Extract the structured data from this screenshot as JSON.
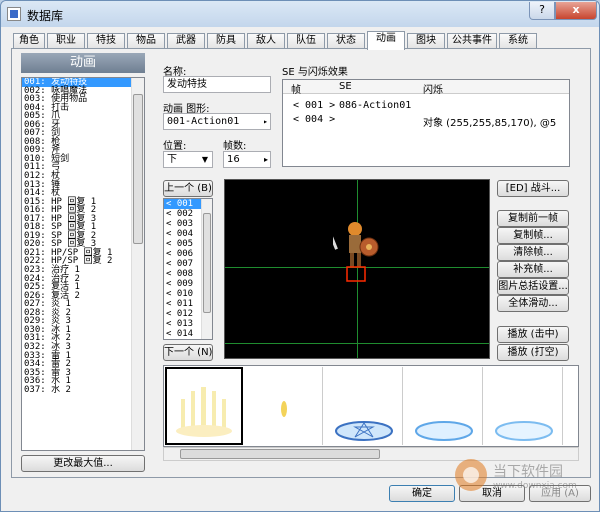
{
  "window": {
    "title": "数据库",
    "help": "?",
    "close": "x"
  },
  "tabs": [
    "角色",
    "职业",
    "特技",
    "物品",
    "武器",
    "防具",
    "敌人",
    "队伍",
    "状态",
    "动画",
    "图块",
    "公共事件",
    "系统"
  ],
  "left": {
    "header": "动画",
    "items": [
      "001: 发动特技",
      "002: 咏唱魔法",
      "003: 使用物品",
      "004: 打击",
      "005: 爪",
      "006: 牙",
      "007: 剑",
      "008: 枪",
      "009: 斧",
      "010: 短剑",
      "011: 弓",
      "012: 杖",
      "013: 锤",
      "014: 杖",
      "015: HP 回复 1",
      "016: HP 回复 2",
      "017: HP 回复 3",
      "018: SP 回复 1",
      "019: SP 回复 2",
      "020: SP 回复 3",
      "021: HP/SP 回复 1",
      "022: HP/SP 回复 2",
      "023: 治疗 1",
      "024: 治疗 2",
      "025: 复活 1",
      "026: 复活 2",
      "027: 炎 1",
      "028: 炎 2",
      "029: 炎 3",
      "030: 冰 1",
      "031: 冰 2",
      "032: 冰 3",
      "033: 雷 1",
      "034: 雷 2",
      "035: 雷 3",
      "036: 水 1",
      "037: 水 2"
    ],
    "change_max": "更改最大值..."
  },
  "props": {
    "name_label": "名称:",
    "name_value": "发动特技",
    "graphic_label": "动画 图形:",
    "graphic_value": "001-Action01",
    "position_label": "位置:",
    "position_value": "下",
    "frames_label": "帧数:",
    "frames_value": "16"
  },
  "se": {
    "title": "SE 与闪烁效果",
    "col_frame": "帧",
    "col_se": "SE",
    "col_flash": "闪烁",
    "rows": [
      {
        "frame": "< 001 >",
        "se": "086-Action01",
        "flash": ""
      },
      {
        "frame": "< 004 >",
        "se": "",
        "flash": "对象 (255,255,85,170), @5"
      }
    ]
  },
  "frames": {
    "prev": "上一个 (B)",
    "next": "下一个 (N)",
    "items": [
      "< 001",
      "< 002",
      "< 003",
      "< 004",
      "< 005",
      "< 006",
      "< 007",
      "< 008",
      "< 009",
      "< 010",
      "< 011",
      "< 012",
      "< 013",
      "< 014"
    ]
  },
  "actions": {
    "battle": "[ED] 战斗...",
    "copy_prev": "复制前一帧",
    "copy_frame": "复制帧...",
    "clear_frame": "清除帧...",
    "fill_frame": "补充帧...",
    "cell_batch": "图片总括设置...",
    "move_all": "全体滑动...",
    "play_hit": "播放 (击中)",
    "play_miss": "播放 (打空)"
  },
  "footer": {
    "ok": "确定",
    "cancel": "取消",
    "apply": "应用 (A)"
  },
  "watermark": {
    "line1": "当下软件园",
    "line2": "www.downxia.com"
  }
}
